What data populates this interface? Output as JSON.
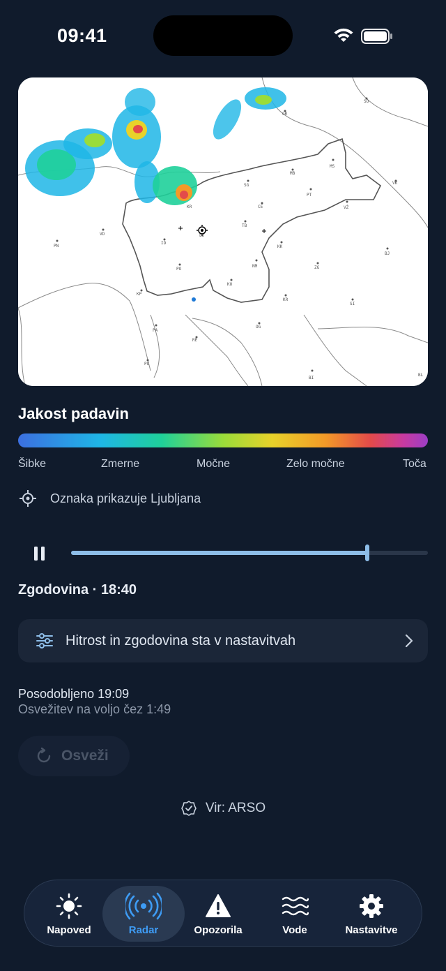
{
  "status": {
    "time": "09:41",
    "wifi_icon": "wifi-icon",
    "battery_icon": "battery-icon"
  },
  "radar": {
    "image_description_icon": "radar-map",
    "labels": [
      "SO",
      "GR",
      "MB",
      "MS",
      "SG",
      "PT",
      "CE",
      "VŽ",
      "TB",
      "KR",
      "NM",
      "KK",
      "ZG",
      "BJ",
      "KO",
      "KA",
      "SI",
      "OG",
      "PO",
      "ID",
      "VD",
      "PN",
      "KP",
      "PA",
      "RE",
      "PU",
      "BI",
      "BL",
      "VK",
      "LJ",
      "KR"
    ]
  },
  "legend": {
    "title": "Jakost padavin",
    "labels": [
      "Šibke",
      "Zmerne",
      "Močne",
      "Zelo močne",
      "Toča"
    ],
    "colors": [
      "#3c6fe0",
      "#1fb6e6",
      "#1fd09a",
      "#9adc3a",
      "#e8d22a",
      "#f39a28",
      "#e34a4a",
      "#c83aa0",
      "#9c3ec6"
    ]
  },
  "marker": {
    "icon": "location-target-icon",
    "text": "Oznaka prikazuje Ljubljana"
  },
  "playback": {
    "state": "paused",
    "progress": 0.83,
    "history_label": "Zgodovina · 18:40"
  },
  "settings_link": {
    "icon": "sliders-icon",
    "label": "Hitrost in zgodovina sta v nastavitvah"
  },
  "update": {
    "updated": "Posodobljeno 19:09",
    "refresh_hint": "Osvežitev na voljo čez 1:49"
  },
  "refresh_button": {
    "label": "Osveži",
    "icon": "refresh-icon",
    "enabled": false
  },
  "source": {
    "icon": "verified-badge-icon",
    "label": "Vir: ARSO"
  },
  "tabs": [
    {
      "label": "Napoved",
      "icon": "sun-icon",
      "active": false
    },
    {
      "label": "Radar",
      "icon": "radar-icon",
      "active": true
    },
    {
      "label": "Opozorila",
      "icon": "warning-icon",
      "active": false
    },
    {
      "label": "Vode",
      "icon": "waves-icon",
      "active": false
    },
    {
      "label": "Nastavitve",
      "icon": "gear-icon",
      "active": false
    }
  ],
  "accent": "#3e9cf5"
}
